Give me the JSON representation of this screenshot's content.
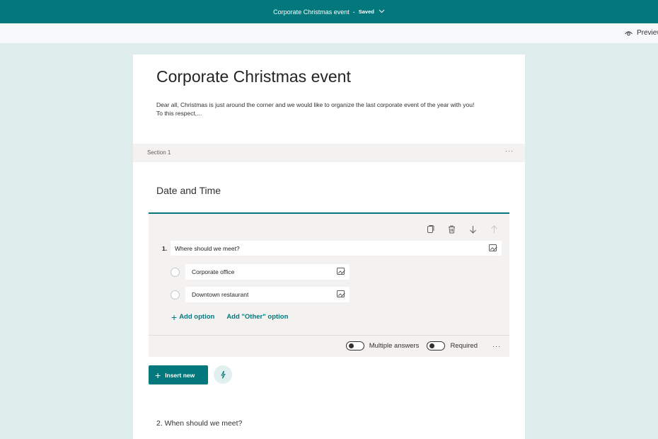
{
  "header": {
    "form_name": "Corporate Christmas event",
    "separator": "-",
    "status": "Saved",
    "chevron_icon": "chevron-down-icon"
  },
  "subbar": {
    "preview_label": "Preview",
    "preview_icon": "eye-icon"
  },
  "form": {
    "title": "Corporate Christmas event",
    "description_line1": "Dear all, Christmas is just around the corner and we would like to organize the last corporate event of the year with you!",
    "description_line2": "To this respect,..."
  },
  "section": {
    "label": "Section 1",
    "more": "···"
  },
  "subtitle": "Date and Time",
  "question1": {
    "number": "1.",
    "text": "Where should we meet?",
    "tools": [
      "copy-icon",
      "trash-icon",
      "arrow-down-icon",
      "arrow-up-icon"
    ],
    "options": [
      {
        "label": "Corporate office"
      },
      {
        "label": "Downtown restaurant"
      }
    ],
    "add_option": "Add option",
    "add_other": "Add \"Other\" option",
    "multiple_answers_label": "Multiple answers",
    "multiple_answers_on": false,
    "required_label": "Required",
    "required_on": false,
    "more": "···"
  },
  "insert": {
    "label": "Insert new",
    "plus": "+"
  },
  "question2": {
    "text": "2. When should we meet?"
  },
  "colors": {
    "accent": "#03787c",
    "background": "#deeceb",
    "panel": "#f3f2f1"
  }
}
